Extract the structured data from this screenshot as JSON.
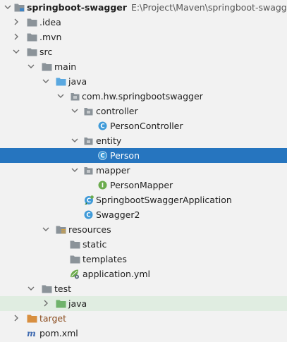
{
  "project": {
    "name": "springboot-swagger",
    "path": "E:\\Project\\Maven\\springboot-swagger"
  },
  "colors": {
    "selection": "#2675bf",
    "test_source_tint": "#e0ede1",
    "folder": "#8b9399",
    "source_folder": "#5aa8e0",
    "test_folder": "#6fb36b",
    "class_icon": "#3f9ad8",
    "interface_icon": "#6bab4d",
    "target_folder": "#d88f40"
  },
  "tree": {
    "idea": ".idea",
    "mvn": ".mvn",
    "src": "src",
    "main": "main",
    "java": "java",
    "package": "com.hw.springbootswagger",
    "controller": "controller",
    "person_controller": "PersonController",
    "entity": "entity",
    "person": "Person",
    "mapper": "mapper",
    "person_mapper": "PersonMapper",
    "application_class": "SpringbootSwaggerApplication",
    "swagger2": "Swagger2",
    "resources": "resources",
    "static": "static",
    "templates": "templates",
    "application_yml": "application.yml",
    "test": "test",
    "test_java": "java",
    "target": "target",
    "pom": "pom.xml"
  },
  "icon_letters": {
    "class": "C",
    "interface": "I",
    "maven": "m"
  }
}
